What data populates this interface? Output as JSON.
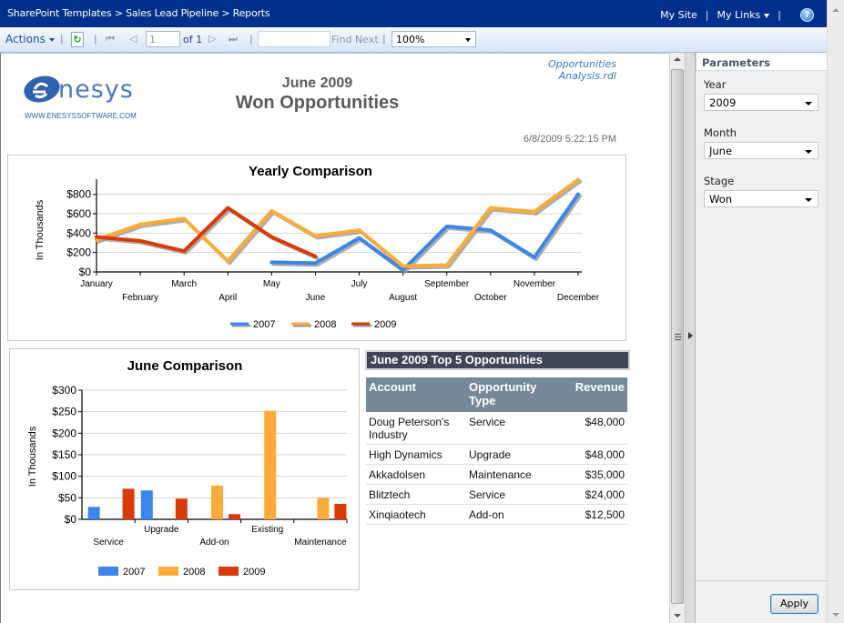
{
  "topbar": {
    "breadcrumb": "SharePoint Templates > Sales Lead Pipeline > Reports",
    "my_site": "My Site",
    "my_links": "My Links",
    "separator": "|",
    "help_icon": "?"
  },
  "toolbar": {
    "actions_label": "Actions",
    "separator": "|",
    "refresh_icon": "↻",
    "first_page_icon": "⏮",
    "prev_page_icon": "◁",
    "page_value": "1",
    "page_of": "of 1",
    "next_page_icon": "▷",
    "last_page_icon": "⏭",
    "find_value": "",
    "find_next_label": "Find Next",
    "zoom_value": "100%"
  },
  "report": {
    "logo_text": "nesys",
    "logo_url_text": "WWW.ENESYSSOFTWARE.COM",
    "month": "June 2009",
    "title": "Won Opportunities",
    "file_line1": "Opportunities",
    "file_line2": "Analysis.rdl",
    "timestamp": "6/8/2009 5:22:15 PM",
    "top5": {
      "title": "June 2009 Top 5 Opportunities",
      "headers": [
        "Account",
        "Opportunity Type",
        "Revenue"
      ],
      "rows": [
        [
          "Doug Peterson's Industry",
          "Service",
          "$48,000"
        ],
        [
          "High Dynamics",
          "Upgrade",
          "$48,000"
        ],
        [
          "Akkadolsen",
          "Maintenance",
          "$35,000"
        ],
        [
          "Blitztech",
          "Service",
          "$24,000"
        ],
        [
          "Xinqiaotech",
          "Add-on",
          "$12,500"
        ]
      ]
    }
  },
  "colors": {
    "s2007": "#3d85e8",
    "s2008": "#fbab38",
    "s2009": "#d93a0a",
    "topbar": "#00308a"
  },
  "chart_data": [
    {
      "type": "line",
      "title": "Yearly Comparison",
      "xlabel": "",
      "ylabel": "In Thousands",
      "ylim": [
        0,
        900
      ],
      "yticks": [
        0,
        200,
        400,
        600,
        800
      ],
      "ytick_labels": [
        "$0",
        "$200",
        "$400",
        "$600",
        "$800"
      ],
      "grid": true,
      "legend": "bottom",
      "categories": [
        "January",
        "February",
        "March",
        "April",
        "May",
        "June",
        "July",
        "August",
        "September",
        "October",
        "November",
        "December"
      ],
      "series": [
        {
          "name": "2007",
          "values": [
            null,
            null,
            null,
            null,
            100,
            90,
            350,
            20,
            470,
            430,
            150,
            800
          ]
        },
        {
          "name": "2008",
          "values": [
            330,
            490,
            550,
            110,
            630,
            370,
            430,
            60,
            70,
            660,
            620,
            950
          ]
        },
        {
          "name": "2009",
          "values": [
            360,
            320,
            215,
            660,
            360,
            160,
            null,
            null,
            null,
            null,
            null,
            null
          ]
        }
      ]
    },
    {
      "type": "bar",
      "title": "June Comparison",
      "xlabel": "",
      "ylabel": "In Thousands",
      "ylim": [
        0,
        300
      ],
      "yticks": [
        0,
        50,
        100,
        150,
        200,
        250,
        300
      ],
      "ytick_labels": [
        "$0",
        "$50",
        "$100",
        "$150",
        "$200",
        "$250",
        "$300"
      ],
      "grid": true,
      "legend": "bottom",
      "categories": [
        "Service",
        "Upgrade",
        "Add-on",
        "Existing",
        "Maintenance"
      ],
      "series": [
        {
          "name": "2007",
          "values": [
            29,
            67,
            0,
            0,
            0
          ]
        },
        {
          "name": "2008",
          "values": [
            0,
            0,
            78,
            252,
            50
          ]
        },
        {
          "name": "2009",
          "values": [
            71,
            48,
            12,
            0,
            36
          ]
        }
      ]
    }
  ],
  "params": {
    "header": "Parameters",
    "year_label": "Year",
    "year_value": "2009",
    "month_label": "Month",
    "month_value": "June",
    "stage_label": "Stage",
    "stage_value": "Won",
    "apply_label": "Apply"
  }
}
